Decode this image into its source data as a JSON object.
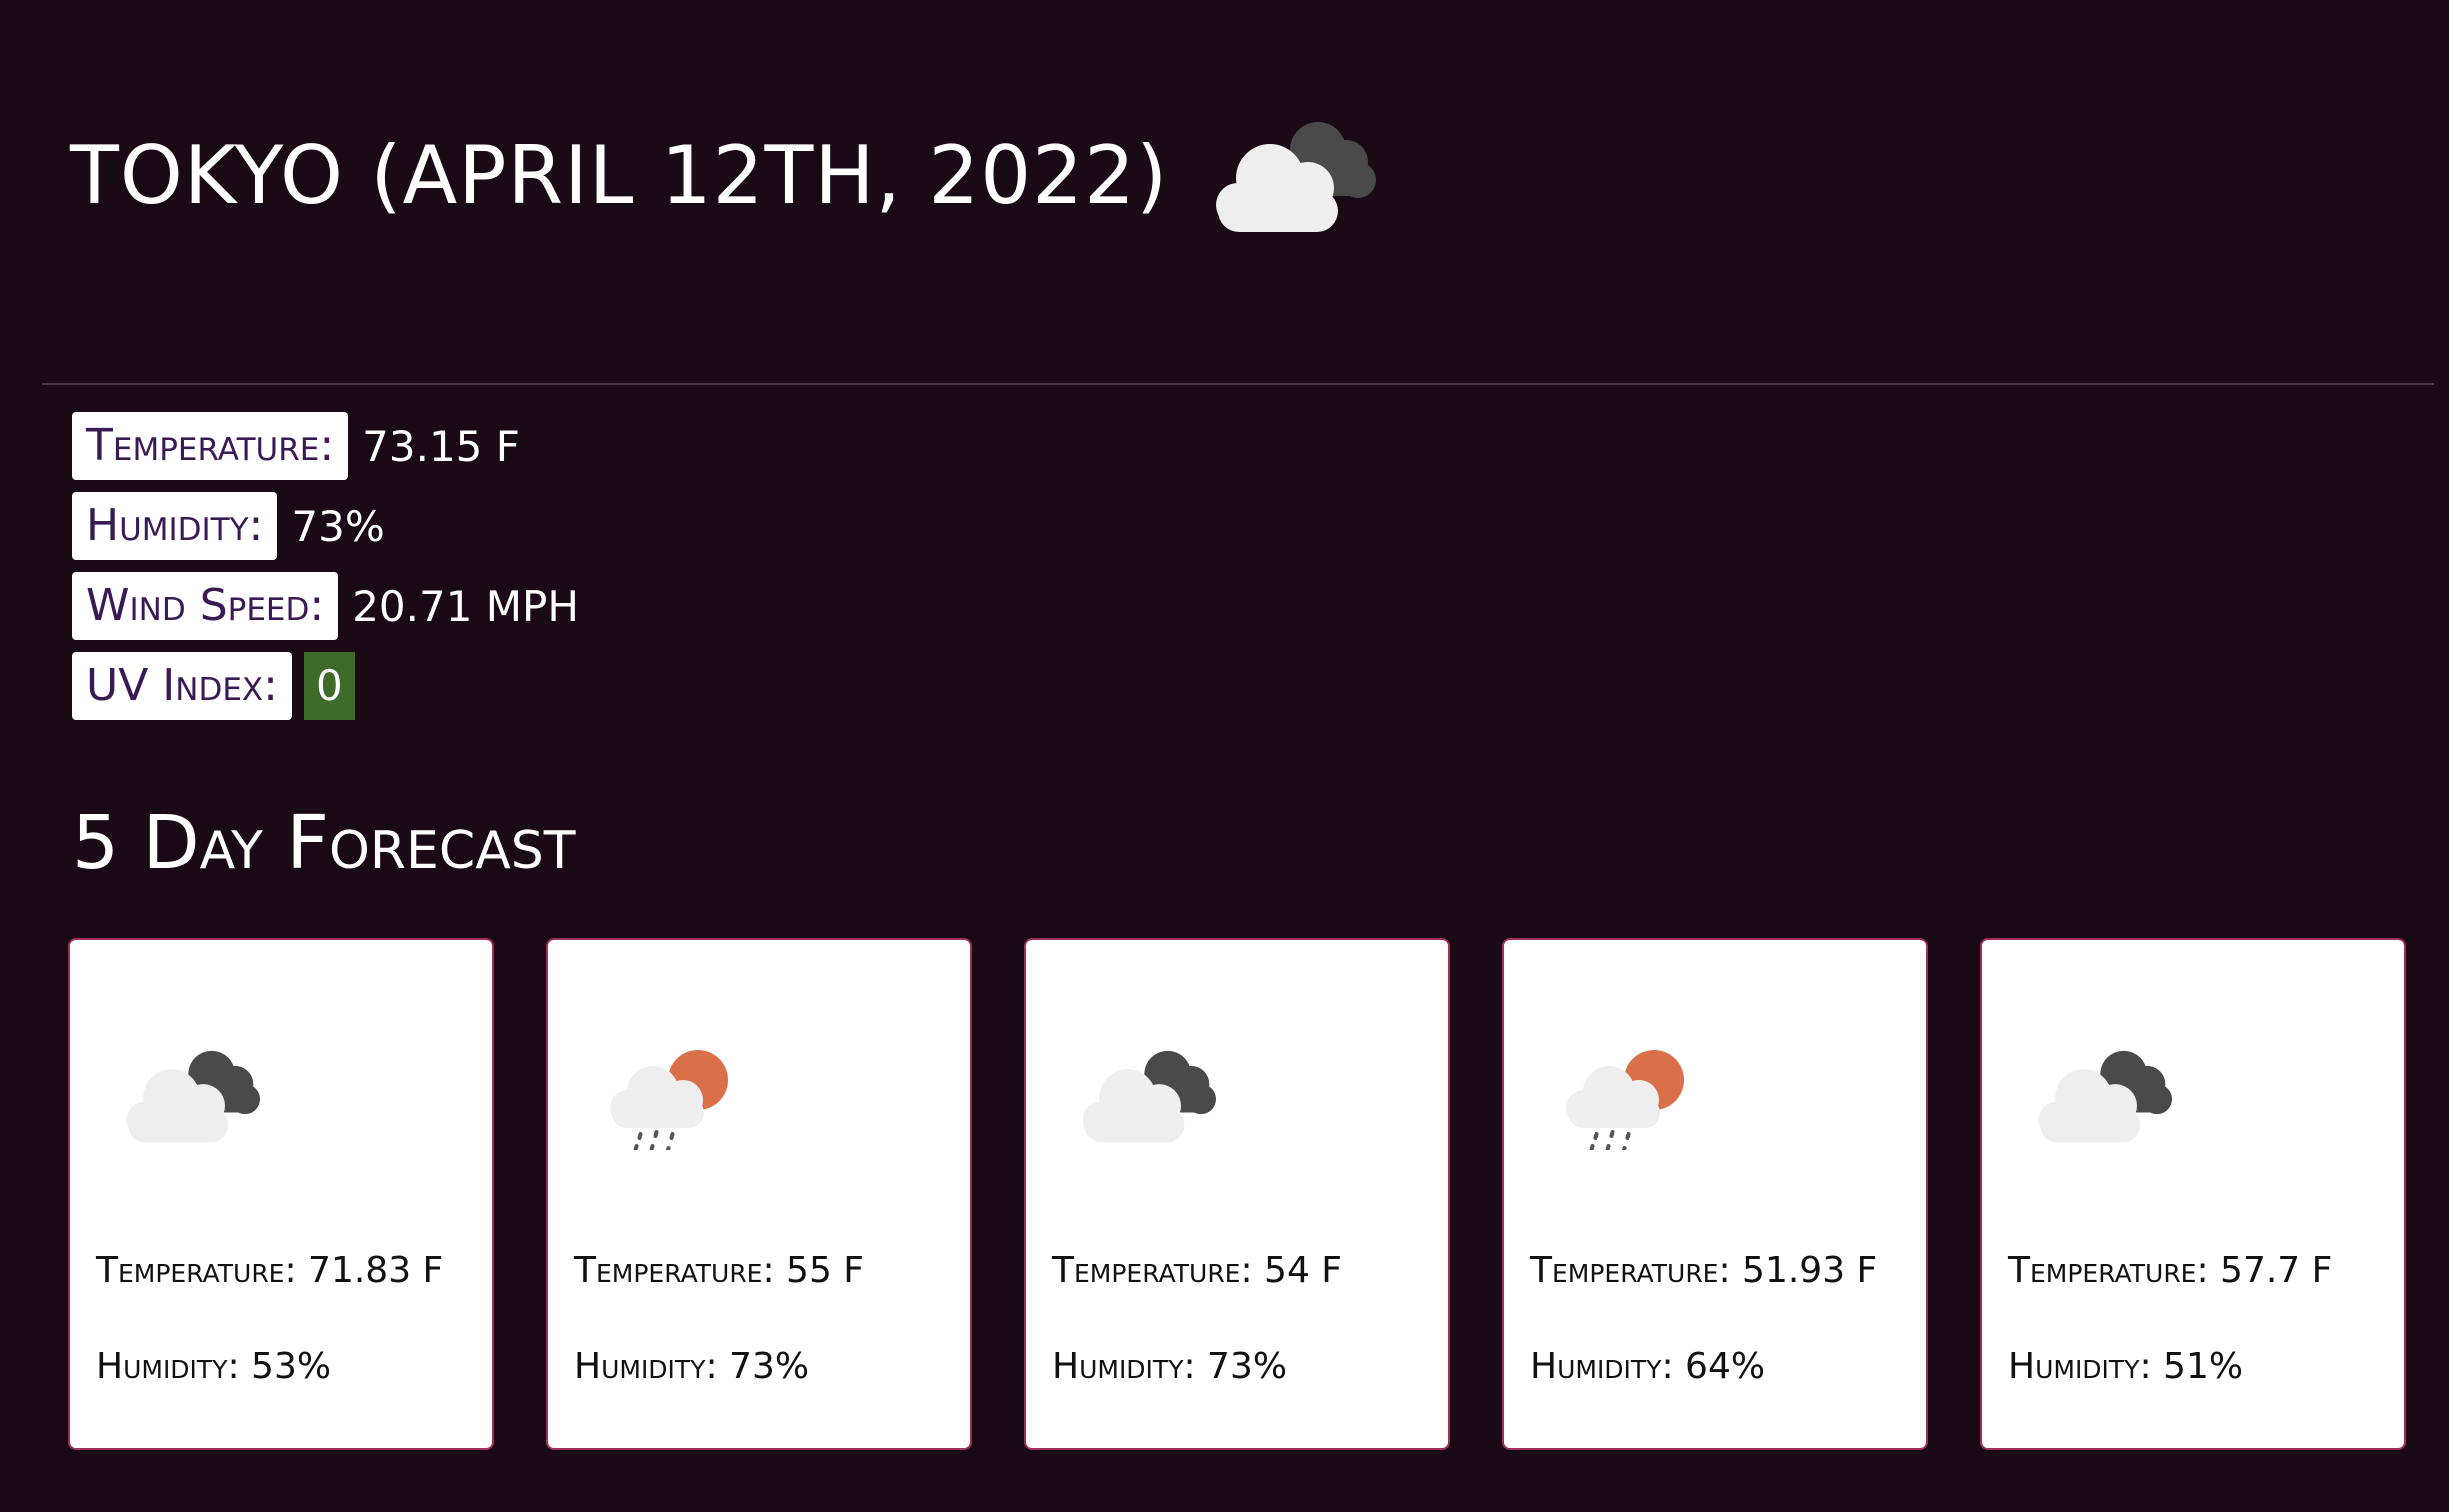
{
  "current": {
    "title": "Tokyo (April 12th, 2022)",
    "icon": "broken-clouds-icon",
    "stats": [
      {
        "label": "Temperature:",
        "value": "73.15 F"
      },
      {
        "label": "Humidity:",
        "value": "73%"
      },
      {
        "label": "Wind Speed:",
        "value": "20.71 MPH"
      }
    ],
    "uv": {
      "label": "UV Index:",
      "value": "0",
      "color": "#3e6b2a"
    }
  },
  "forecast": {
    "title": "5 Day Forecast",
    "days": [
      {
        "icon": "broken-clouds-icon",
        "temperature": "Temperature: 71.83 F",
        "humidity": "Humidity: 53%"
      },
      {
        "icon": "rain-sun-icon",
        "temperature": "Temperature: 55 F",
        "humidity": "Humidity: 73%"
      },
      {
        "icon": "broken-clouds-icon",
        "temperature": "Temperature: 54 F",
        "humidity": "Humidity: 73%"
      },
      {
        "icon": "rain-sun-icon",
        "temperature": "Temperature: 51.93 F",
        "humidity": "Humidity: 64%"
      },
      {
        "icon": "broken-clouds-icon",
        "temperature": "Temperature: 57.7 F",
        "humidity": "Humidity: 51%"
      }
    ]
  },
  "colors": {
    "background": "#190a15",
    "label_text": "#3a1a55",
    "card_border": "#a0305a",
    "sun": "#d9704a"
  }
}
